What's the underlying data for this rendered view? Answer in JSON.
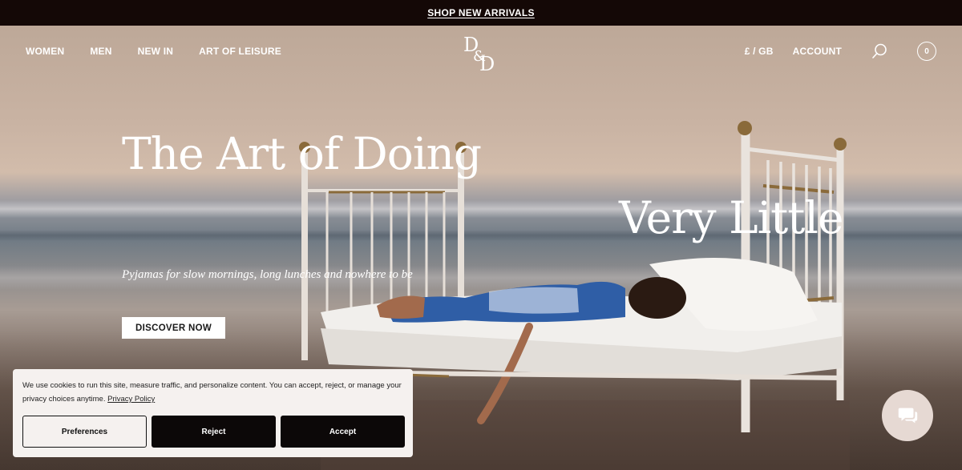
{
  "promo": {
    "label": "SHOP NEW ARRIVALS"
  },
  "nav": {
    "left_items": [
      {
        "label": "WOMEN"
      },
      {
        "label": "MEN"
      },
      {
        "label": "NEW IN"
      },
      {
        "label": "ART OF LEISURE"
      }
    ],
    "logo_text": "D&D",
    "currency": "£ / GB",
    "account": "ACCOUNT",
    "search_icon": "search-icon",
    "cart_count": "0"
  },
  "hero": {
    "headline_1": "The Art of Doing",
    "headline_2": "Very Little",
    "subhead": "Pyjamas for slow mornings, long lunches and nowhere to be",
    "cta": "DISCOVER NOW"
  },
  "cookie": {
    "text": "We use cookies to run this site, measure traffic, and personalize content. You can accept, reject, or manage your privacy choices anytime.",
    "link": "Privacy Policy",
    "preferences": "Preferences",
    "reject": "Reject",
    "accept": "Accept"
  },
  "chat": {
    "icon": "chat-icon"
  },
  "colors": {
    "promo_bg": "#140806",
    "cookie_bg": "#f5f1ef",
    "button_dark": "#0c0808",
    "chat_bg": "#e6d9d3"
  }
}
